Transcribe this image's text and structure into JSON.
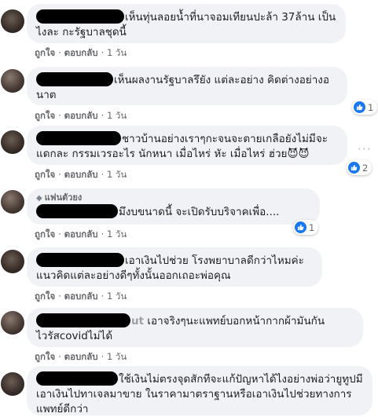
{
  "comments": [
    {
      "text": "เห็นทุ่นลอยน้ำที่นาจอมเทียนปะล้า 37ล้าน เป็นไงละ กะรัฐบาลชุดนี้",
      "actions": {
        "like": "ถูกใจ",
        "reply": "ตอบกลับ",
        "time": "1 วัน"
      }
    },
    {
      "text": "เห็นผลงานรัฐบาลรึยัง แต่ละอย่าง คิดต่างอย่างอนาต",
      "actions": {
        "like": "ถูกใจ",
        "reply": "ตอบกลับ",
        "time": "1 วัน"
      },
      "reaction": {
        "icon": "thumbs-up-icon",
        "count": "1"
      }
    },
    {
      "text": "ชาวบ้านอย่างเราๆกะจนจะตายเกลือยังไม่มีจะแดกละ กรรมเวรอะไร นักหนา เมื่อไหร่ หัะ เมื่อไหร่ ฮ่วย😈😈",
      "actions": {
        "like": "ถูกใจ",
        "reply": "ตอบกลับ",
        "time": "1 วัน"
      },
      "reaction": {
        "icon": "thumbs-up-icon",
        "count": "2"
      },
      "menu": "···"
    },
    {
      "badge": "แฟนตัวยง",
      "text": "มึงบขนาดนี้ จะเปิดรับบริจาคเพื่อ....",
      "actions": {
        "like": "ถูกใจ",
        "reply": "ตอบกลับ",
        "time": "1 วัน"
      },
      "reaction": {
        "icon": "thumbs-up-icon",
        "count": "1"
      }
    },
    {
      "text": "เอาเงินไปช่วย โรงพยาบาลดีกว่าไหมค่ะแนวคิดแต่ละอย่างดีๆทั้งนั้นออกเถอะพ่อคุณ",
      "actions": {
        "like": "ถูกใจ",
        "reply": "ตอบกลับ",
        "time": "1 วัน"
      }
    },
    {
      "name_tail": "ut",
      "text": "เอาจริงๆนะแพทย์บอกหน้ากากผ้ามันกันไวรัสcovidไม่ได้",
      "actions": {
        "like": "ถูกใจ",
        "reply": "ตอบกลับ",
        "time": "1 วัน"
      }
    },
    {
      "text": "ใช้เงินไม่ตรงจุดสักทีจะแก้ปัญหาได้ไงอย่างพ่อว่ายูทูปมีเอาเงินไปทาเจลมาขาย ในราคามาตราฐานหรือเอาเงินไปช่วยทางการแพทย์ดีกว่า"
    }
  ],
  "colors": {
    "bubble": "#f0f2f5",
    "meta_text": "#65676b",
    "like_blue": "#1877f2"
  }
}
